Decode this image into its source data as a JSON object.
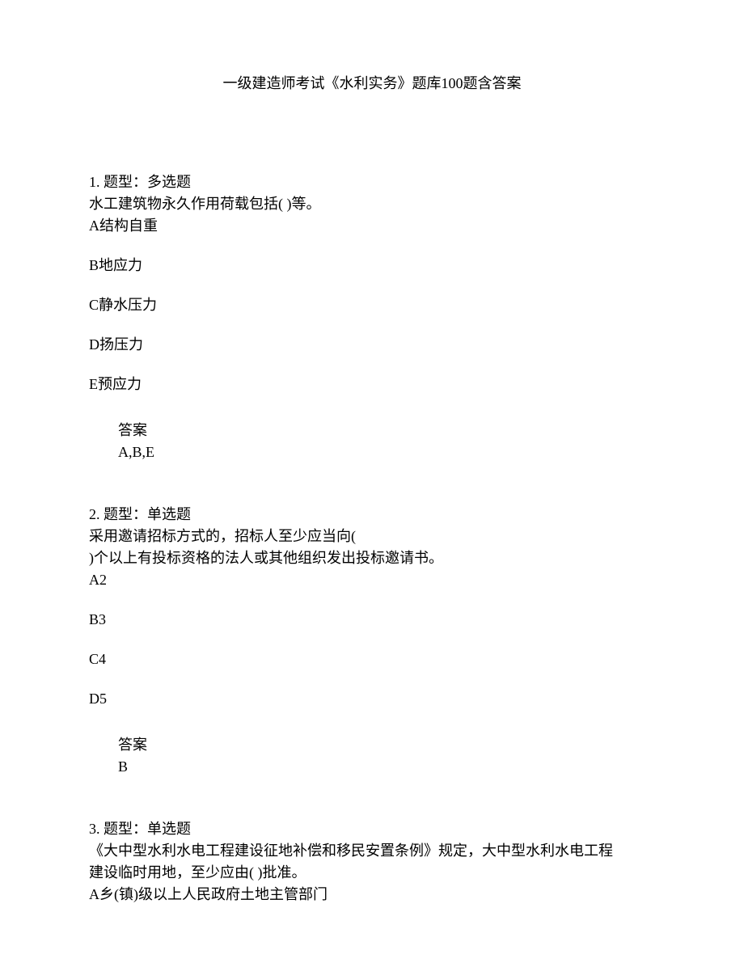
{
  "title": "一级建造师考试《水利实务》题库100题含答案",
  "questions": [
    {
      "number": "1",
      "type_label": "题型：多选题",
      "stem": "水工建筑物永久作用荷载包括( )等。",
      "options": [
        "A结构自重",
        "B地应力",
        "C静水压力",
        "D扬压力",
        "E预应力"
      ],
      "answer_label": "答案",
      "answer": "A,B,E"
    },
    {
      "number": "2",
      "type_label": "题型：单选题",
      "stem_line1": "采用邀请招标方式的，招标人至少应当向(",
      "stem_line2": ")个以上有投标资格的法人或其他组织发出投标邀请书。",
      "options": [
        "A2",
        "B3",
        "C4",
        "D5"
      ],
      "answer_label": "答案",
      "answer": "B"
    },
    {
      "number": "3",
      "type_label": "题型：单选题",
      "stem_line1": "《大中型水利水电工程建设征地补偿和移民安置条例》规定，大中型水利水电工程",
      "stem_line2": "建设临时用地，至少应由( )批准。",
      "options_partial": [
        "A乡(镇)级以上人民政府土地主管部门"
      ]
    }
  ]
}
